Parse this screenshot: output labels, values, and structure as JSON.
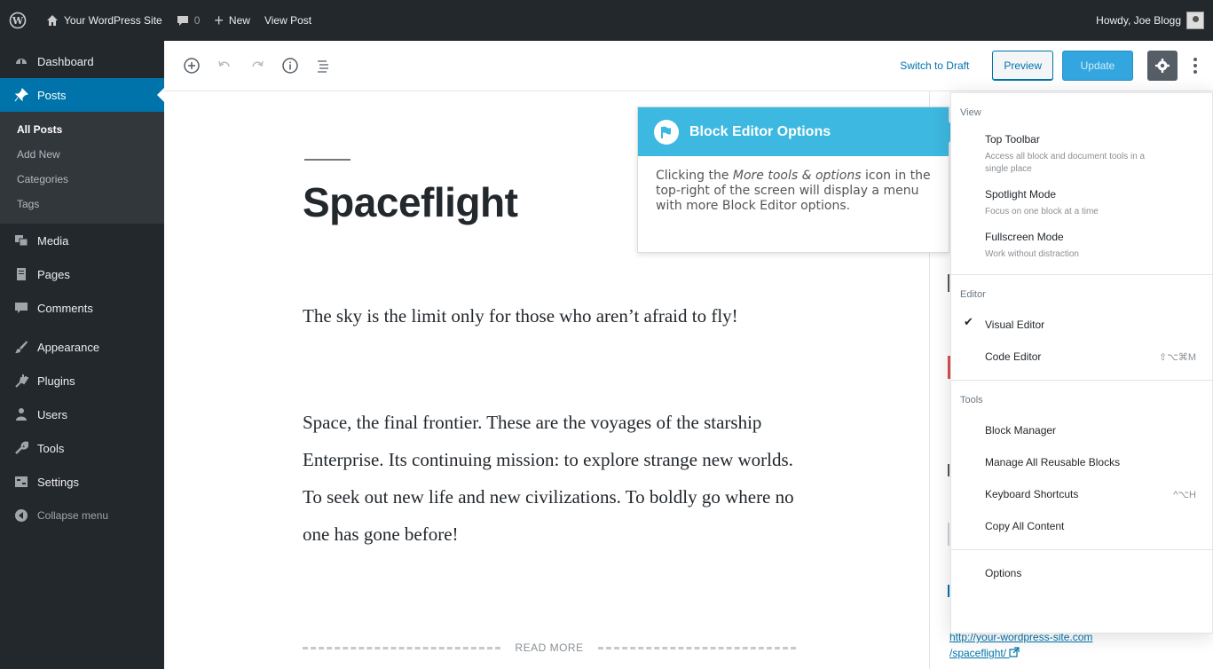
{
  "adminbar": {
    "site_name": "Your WordPress Site",
    "comments_count": "0",
    "new_label": "New",
    "view_post_label": "View Post",
    "howdy": "Howdy, Joe Blogg"
  },
  "sidebar": {
    "items": [
      {
        "label": "Dashboard",
        "icon": "dashboard-icon"
      },
      {
        "label": "Posts",
        "icon": "pin-icon"
      },
      {
        "label": "Media",
        "icon": "media-icon"
      },
      {
        "label": "Pages",
        "icon": "pages-icon"
      },
      {
        "label": "Comments",
        "icon": "comment-icon"
      },
      {
        "label": "Appearance",
        "icon": "brush-icon"
      },
      {
        "label": "Plugins",
        "icon": "plug-icon"
      },
      {
        "label": "Users",
        "icon": "users-icon"
      },
      {
        "label": "Tools",
        "icon": "wrench-icon"
      },
      {
        "label": "Settings",
        "icon": "settings-icon"
      },
      {
        "label": "Collapse menu",
        "icon": "collapse-icon"
      }
    ],
    "posts_submenu": [
      "All Posts",
      "Add New",
      "Categories",
      "Tags"
    ]
  },
  "header": {
    "switch_to_draft": "Switch to Draft",
    "preview": "Preview",
    "update": "Update"
  },
  "post": {
    "title": "Spaceflight",
    "paragraph1": "The sky is the limit only for those who aren’t afraid to fly!",
    "paragraph2": "Space, the final frontier. These are the voyages of the starship Enterprise. Its  continuing mission: to explore strange new worlds. To seek out new life  and new civilizations. To boldly go where no one has gone before!",
    "read_more": "READ MORE"
  },
  "tip": {
    "title": "Block Editor Options",
    "body_before": "Clicking the ",
    "body_em": "More tools & options",
    "body_after": " icon in the top-right of the screen will display a menu with more Block Editor options."
  },
  "permalink": {
    "line1": "http://your-wordpress-site.com",
    "line2": "/spaceflight/"
  },
  "more_menu": {
    "view_label": "View",
    "view_items": [
      {
        "label": "Top Toolbar",
        "desc": "Access all block and document tools in a single place"
      },
      {
        "label": "Spotlight Mode",
        "desc": "Focus on one block at a time"
      },
      {
        "label": "Fullscreen Mode",
        "desc": "Work without distraction"
      }
    ],
    "editor_label": "Editor",
    "visual_editor": "Visual Editor",
    "code_editor": "Code Editor",
    "code_editor_shortcut": "⇧⌥⌘M",
    "tools_label": "Tools",
    "block_manager": "Block Manager",
    "manage_reusable": "Manage All Reusable Blocks",
    "keyboard_shortcuts": "Keyboard Shortcuts",
    "keyboard_shortcuts_shortcut": "^⌥H",
    "copy_all": "Copy All Content",
    "options": "Options"
  },
  "colors": {
    "admin_dark": "#23282d",
    "admin_blue": "#0073aa",
    "tip_blue": "#3db8e0",
    "update_blue": "#33a6e0"
  }
}
